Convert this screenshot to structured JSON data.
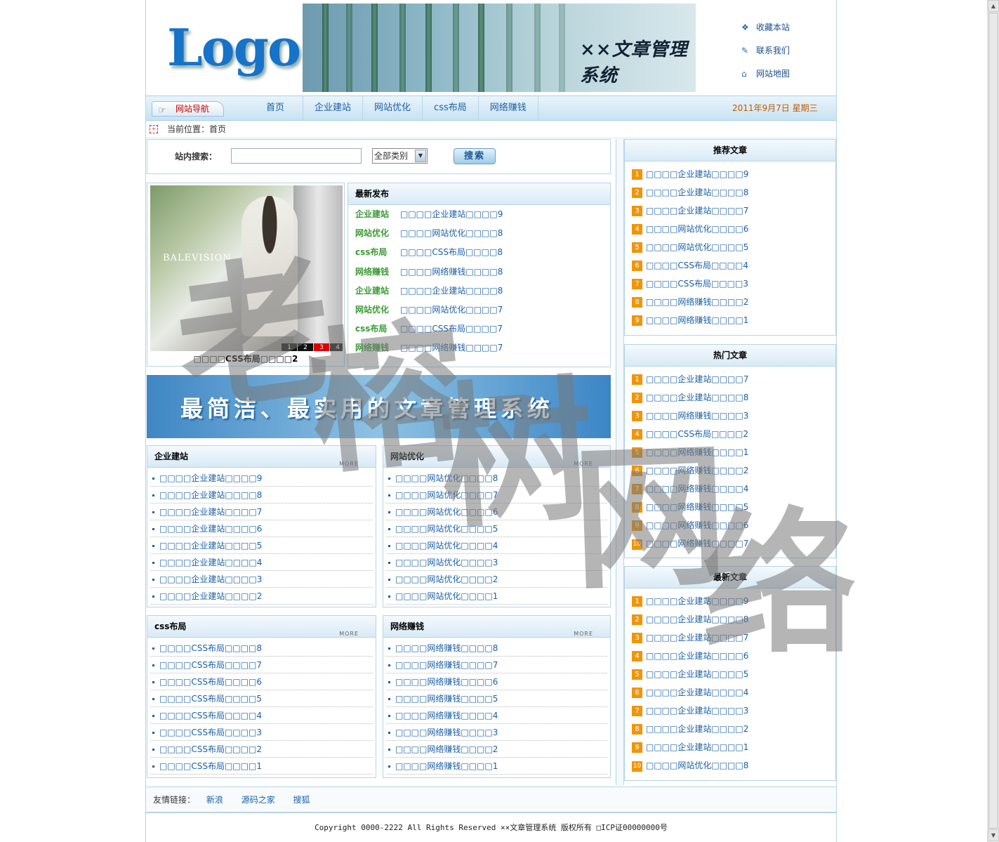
{
  "header": {
    "logo_text": "Logo",
    "banner_title": "××文章管理系统",
    "top_links": [
      {
        "label": "收藏本站",
        "icon": "bookmark-icon"
      },
      {
        "label": "联系我们",
        "icon": "contact-icon"
      },
      {
        "label": "网站地图",
        "icon": "home-icon"
      }
    ]
  },
  "nav": {
    "label": "网站导航",
    "items": [
      "首页",
      "企业建站",
      "网站优化",
      "css布局",
      "网络赚钱"
    ],
    "date": "2011年9月7日 星期三"
  },
  "breadcrumb": "当前位置：首页",
  "search": {
    "label": "站内搜索：",
    "input_value": "",
    "category": "全部类别",
    "button": "搜索"
  },
  "slideshow": {
    "brand": "BALEVISION",
    "numbers": [
      "1",
      "2",
      "3",
      "4"
    ],
    "active": 2,
    "caption": "□□□□CSS布局□□□□2"
  },
  "latest": {
    "title": "最新发布",
    "rows": [
      {
        "cat": "企业建站",
        "title": "□□□□企业建站□□□□9"
      },
      {
        "cat": "网站优化",
        "title": "□□□□网站优化□□□□8"
      },
      {
        "cat": "css布局",
        "title": "□□□□CSS布局□□□□8"
      },
      {
        "cat": "网络赚钱",
        "title": "□□□□网络赚钱□□□□8"
      },
      {
        "cat": "企业建站",
        "title": "□□□□企业建站□□□□8"
      },
      {
        "cat": "网站优化",
        "title": "□□□□网站优化□□□□7"
      },
      {
        "cat": "css布局",
        "title": "□□□□CSS布局□□□□7"
      },
      {
        "cat": "网络赚钱",
        "title": "□□□□网络赚钱□□□□7"
      }
    ]
  },
  "ad_text": "最简洁、最实用的文章管理系统",
  "more_label": "MORE",
  "categories": [
    {
      "title": "企业建站",
      "items": [
        "□□□□企业建站□□□□9",
        "□□□□企业建站□□□□8",
        "□□□□企业建站□□□□7",
        "□□□□企业建站□□□□6",
        "□□□□企业建站□□□□5",
        "□□□□企业建站□□□□4",
        "□□□□企业建站□□□□3",
        "□□□□企业建站□□□□2"
      ]
    },
    {
      "title": "网站优化",
      "items": [
        "□□□□网站优化□□□□8",
        "□□□□网站优化□□□□7",
        "□□□□网站优化□□□□6",
        "□□□□网站优化□□□□5",
        "□□□□网站优化□□□□4",
        "□□□□网站优化□□□□3",
        "□□□□网站优化□□□□2",
        "□□□□网站优化□□□□1"
      ]
    },
    {
      "title": "css布局",
      "items": [
        "□□□□CSS布局□□□□8",
        "□□□□CSS布局□□□□7",
        "□□□□CSS布局□□□□6",
        "□□□□CSS布局□□□□5",
        "□□□□CSS布局□□□□4",
        "□□□□CSS布局□□□□3",
        "□□□□CSS布局□□□□2",
        "□□□□CSS布局□□□□1"
      ]
    },
    {
      "title": "网络赚钱",
      "items": [
        "□□□□网络赚钱□□□□8",
        "□□□□网络赚钱□□□□7",
        "□□□□网络赚钱□□□□6",
        "□□□□网络赚钱□□□□5",
        "□□□□网络赚钱□□□□4",
        "□□□□网络赚钱□□□□3",
        "□□□□网络赚钱□□□□2",
        "□□□□网络赚钱□□□□1"
      ]
    }
  ],
  "recommended": {
    "title": "推荐文章",
    "items": [
      "□□□□企业建站□□□□9",
      "□□□□企业建站□□□□8",
      "□□□□企业建站□□□□7",
      "□□□□网站优化□□□□6",
      "□□□□网站优化□□□□5",
      "□□□□CSS布局□□□□4",
      "□□□□CSS布局□□□□3",
      "□□□□网络赚钱□□□□2",
      "□□□□网络赚钱□□□□1"
    ]
  },
  "hot": {
    "title": "热门文章",
    "items": [
      "□□□□企业建站□□□□7",
      "□□□□企业建站□□□□8",
      "□□□□网络赚钱□□□□3",
      "□□□□CSS布局□□□□2",
      "□□□□网络赚钱□□□□1",
      "□□□□网络赚钱□□□□2",
      "□□□□网络赚钱□□□□4",
      "□□□□网络赚钱□□□□5",
      "□□□□网络赚钱□□□□6",
      "□□□□网络赚钱□□□□7"
    ]
  },
  "newest": {
    "title": "最新文章",
    "items": [
      "□□□□企业建站□□□□9",
      "□□□□企业建站□□□□8",
      "□□□□企业建站□□□□7",
      "□□□□企业建站□□□□6",
      "□□□□企业建站□□□□5",
      "□□□□企业建站□□□□4",
      "□□□□企业建站□□□□3",
      "□□□□企业建站□□□□2",
      "□□□□企业建站□□□□1",
      "□□□□网站优化□□□□8"
    ]
  },
  "friends": {
    "label": "友情链接：",
    "links": [
      "新浪",
      "源码之家",
      "搜狐"
    ]
  },
  "footer": "Copyright 0000-2222 All Rights Reserved  ××文章管理系统 版权所有 □ICP证00000000号",
  "watermark": "老榕树网络",
  "colors": {
    "link": "#1a5fa8",
    "accent_green": "#3c9a35",
    "rank_badge": "#f0950a",
    "border": "#b7d4e6",
    "date": "#c35a00"
  }
}
